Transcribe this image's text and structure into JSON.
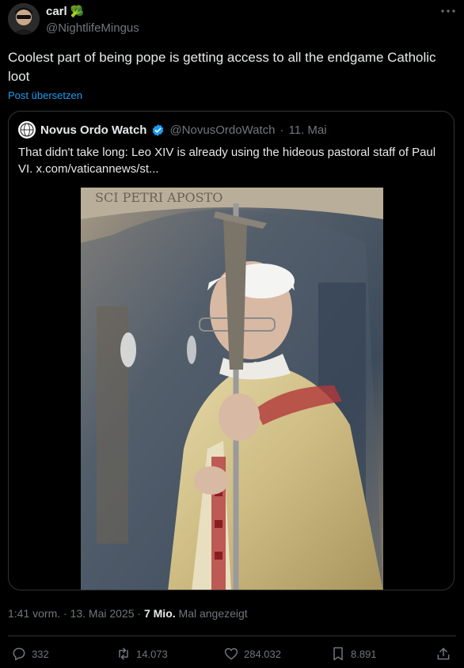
{
  "author": {
    "name": "carl",
    "name_emoji": "🥦",
    "handle": "@NightlifeMingus"
  },
  "tweet": {
    "text": "Coolest part of being pope is getting access to all the endgame Catholic loot",
    "translate_label": "Post übersetzen"
  },
  "quoted": {
    "name": "Novus Ordo Watch",
    "handle": "@NovusOrdoWatch",
    "separator": "·",
    "date": "11. Mai",
    "text": "That didn't take long: Leo XIV is already using the hideous pastoral staff of Paul VI.  x.com/vaticannews/st...",
    "image_inscription": "SCI PETRI APOSTO"
  },
  "meta": {
    "time": "1:41 vorm. · 13. Mai 2025 ·",
    "views": "7 Mio.",
    "views_suffix": "Mal angezeigt"
  },
  "actions": {
    "replies": "332",
    "reposts": "14.073",
    "likes": "284.032",
    "bookmarks": "8.891"
  },
  "colors": {
    "background": "#000000",
    "text": "#e7e9ea",
    "muted": "#71767b",
    "link": "#1d9bf0",
    "verified": "#1d9bf0",
    "border": "#2f3336"
  }
}
